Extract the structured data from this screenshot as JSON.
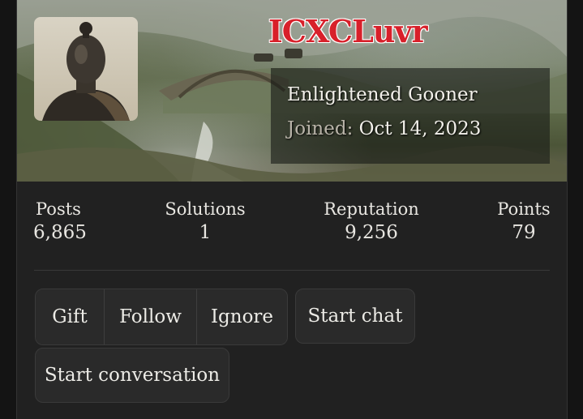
{
  "profile": {
    "username": "ICXCLuvr",
    "user_title": "Enlightened Gooner",
    "joined_label": "Joined:",
    "joined_date": "Oct 14, 2023",
    "username_color": "#d8202a"
  },
  "stats": [
    {
      "label": "Posts",
      "value": "6,865"
    },
    {
      "label": "Solutions",
      "value": "1"
    },
    {
      "label": "Reputation",
      "value": "9,256"
    },
    {
      "label": "Points",
      "value": "79"
    }
  ],
  "actions": {
    "gift": "Gift",
    "follow": "Follow",
    "ignore": "Ignore",
    "start_chat": "Start chat",
    "start_conversation": "Start conversation"
  },
  "banner": {
    "image": "landscape-painting-stone-bridge",
    "avatar": "bronze-bust-portrait"
  }
}
